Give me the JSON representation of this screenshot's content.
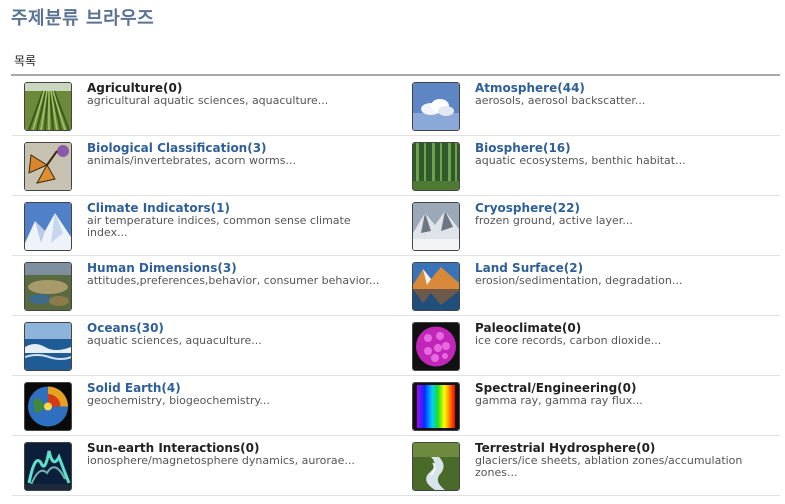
{
  "page": {
    "title": "주제분류 브라우즈",
    "section_label": "목록"
  },
  "categories": [
    {
      "name": "Agriculture(0)",
      "desc": "agricultural aquatic sciences, aquaculture...",
      "link": false,
      "icon": "crop-field-icon"
    },
    {
      "name": "Atmosphere(44)",
      "desc": "aerosols, aerosol backscatter...",
      "link": true,
      "icon": "cloud-sky-icon"
    },
    {
      "name": "Biological Classification(3)",
      "desc": "animals/invertebrates, acorn worms...",
      "link": true,
      "icon": "butterfly-icon"
    },
    {
      "name": "Biosphere(16)",
      "desc": "aquatic ecosystems, benthic habitat...",
      "link": true,
      "icon": "forest-icon"
    },
    {
      "name": "Climate Indicators(1)",
      "desc": "air temperature indices, common sense climate index...",
      "link": true,
      "icon": "glacier-icon"
    },
    {
      "name": "Cryosphere(22)",
      "desc": "frozen ground, active layer...",
      "link": true,
      "icon": "snow-mountain-icon"
    },
    {
      "name": "Human Dimensions(3)",
      "desc": "attitudes,preferences,behavior, consumer behavior...",
      "link": true,
      "icon": "landscape-icon"
    },
    {
      "name": "Land Surface(2)",
      "desc": "erosion/sedimentation, degradation...",
      "link": true,
      "icon": "mountain-lake-icon"
    },
    {
      "name": "Oceans(30)",
      "desc": "aquatic sciences, aquaculture...",
      "link": true,
      "icon": "ocean-wave-icon"
    },
    {
      "name": "Paleoclimate(0)",
      "desc": "ice core records, carbon dioxide...",
      "link": false,
      "icon": "pollen-grain-icon"
    },
    {
      "name": "Solid Earth(4)",
      "desc": "geochemistry, biogeochemistry...",
      "link": true,
      "icon": "earth-cutaway-icon"
    },
    {
      "name": "Spectral/Engineering(0)",
      "desc": "gamma ray, gamma ray flux...",
      "link": false,
      "icon": "spectrum-icon"
    },
    {
      "name": "Sun-earth Interactions(0)",
      "desc": "ionosphere/magnetosphere dynamics, aurorae...",
      "link": false,
      "icon": "aurora-icon"
    },
    {
      "name": "Terrestrial Hydrosphere(0)",
      "desc": "glaciers/ice sheets, ablation zones/accumulation zones...",
      "link": false,
      "icon": "stream-icon"
    }
  ],
  "colors": {
    "title": "#5a7394",
    "link": "#2e5f99",
    "plain": "#222222"
  }
}
